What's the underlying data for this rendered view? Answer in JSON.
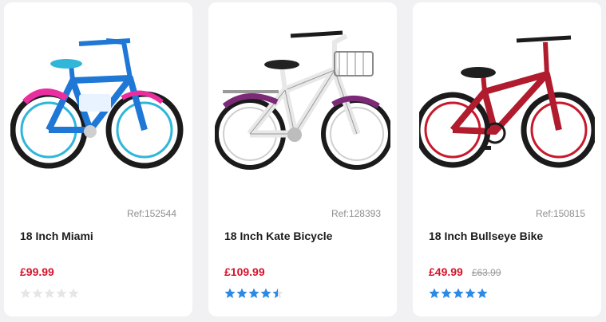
{
  "products": [
    {
      "ref": "Ref:152544",
      "name": "18 Inch Miami",
      "price": "£99.99",
      "was_price": "",
      "rating": 0,
      "colors": {
        "frame": "#1f77d6",
        "accent": "#ea2ea0",
        "seat": "#2fb6d9"
      }
    },
    {
      "ref": "Ref:128393",
      "name": "18 Inch Kate Bicycle",
      "price": "£109.99",
      "was_price": "",
      "rating": 4.5,
      "colors": {
        "frame": "#f2f2f2",
        "accent": "#7c2a78",
        "seat": "#222222"
      }
    },
    {
      "ref": "Ref:150815",
      "name": "18 Inch Bullseye Bike",
      "price": "£49.99",
      "was_price": "£63.99",
      "rating": 5,
      "colors": {
        "frame": "#b01b2e",
        "accent": "#c8192c",
        "seat": "#1f1f1f"
      }
    }
  ],
  "theme": {
    "price": "#d6132c",
    "star_on": "#2a8ae6",
    "star_off": "#e6e6e6"
  }
}
